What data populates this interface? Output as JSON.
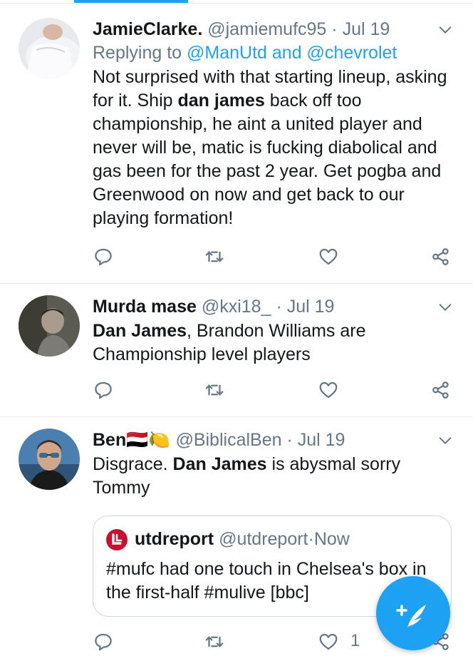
{
  "tweets": [
    {
      "name": "JamieClarke.",
      "handle": "@jamiemufc95",
      "separator": "·",
      "date": "Jul 19",
      "reply_prefix": "Replying to",
      "reply_targets": "@ManUtd and @chevrolet",
      "text_parts": [
        "Not surprised with that starting lineup, asking for it. Ship ",
        "dan james",
        " back off too championship, he aint a united player and never will be, matic is fucking diabolical and gas been for the past 2 year. Get pogba and Greenwood on now and get back to our playing formation!"
      ]
    },
    {
      "name": "Murda mase",
      "handle": "@kxi18_",
      "separator": "·",
      "date": "Jul 19",
      "text_parts": [
        "Dan James",
        ", Brandon Williams are Championship level players"
      ]
    },
    {
      "name": "Ben",
      "name_emoji": "🇾🇪🍋",
      "handle": "@BiblicalBen",
      "separator": "·",
      "date": "Jul 19",
      "text_parts": [
        "Disgrace. ",
        "Dan James",
        " is abysmal sorry Tommy"
      ],
      "quote": {
        "name": "utdreport",
        "handle": "@utdreport",
        "separator": "·",
        "date": "Now",
        "text": "#mufc had one touch in Chelsea's box in the first-half #mulive [bbc]"
      },
      "like_count": "1"
    }
  ],
  "icons": {
    "reply": "reply-icon",
    "retweet": "retweet-icon",
    "like": "like-icon",
    "share": "share-icon",
    "menu": "chevron-down-icon",
    "compose": "compose-tweet-icon"
  },
  "colors": {
    "accent": "#1da1f2",
    "text": "#14171a",
    "muted": "#657786",
    "border": "#e6ecf0",
    "utdreport_brand": "#c8102e"
  }
}
